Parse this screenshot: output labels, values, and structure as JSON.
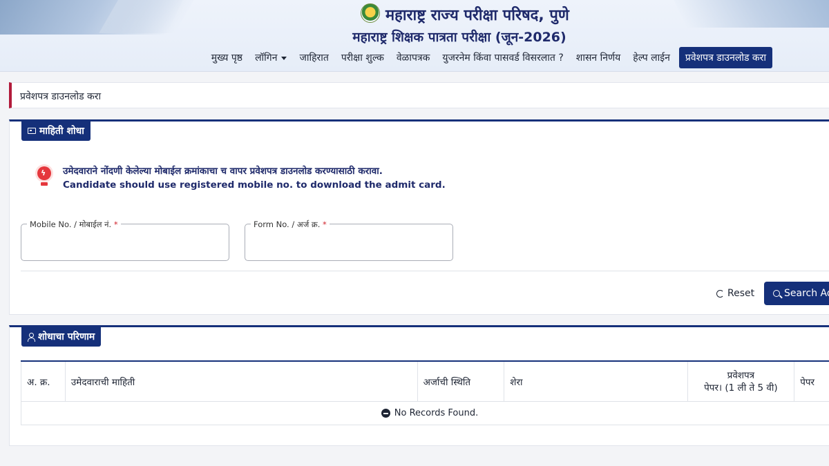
{
  "header": {
    "title": "महाराष्ट्र राज्य परीक्षा परिषद, पुणे",
    "subtitle": "महाराष्ट्र शिक्षक पात्रता परीक्षा (जून-2026)",
    "nav": [
      {
        "label": "मुख्य पृष्ठ"
      },
      {
        "label": "लॉगिन"
      },
      {
        "label": "जाहिरात"
      },
      {
        "label": "परीक्षा शुल्क"
      },
      {
        "label": "वेळापत्रक"
      },
      {
        "label": "युजरनेम किंवा पासवर्ड विसरलात ?"
      },
      {
        "label": "शासन निर्णय"
      },
      {
        "label": "हेल्प लाईन"
      },
      {
        "label": "प्रवेशपत्र डाउनलोड करा"
      }
    ]
  },
  "breadcrumb": "प्रवेशपत्र डाउनलोड करा",
  "search_panel": {
    "tab": "माहिती शोधा",
    "notice_line1": "उमेदवाराने नोंदणी केलेल्या मोबाईल क्रमांकाचा च वापर प्रवेशपत्र डाउनलोड करण्यासाठी करावा.",
    "notice_line2": "Candidate should use registered mobile no. to download the admit card.",
    "mobile_label": "Mobile No. / मोबाईल नं.",
    "mobile_value": "",
    "form_label": "Form No. / अर्ज क्र.",
    "form_value": "",
    "required_mark": "*",
    "reset_label": "Reset",
    "search_label": "Search Ad"
  },
  "result_panel": {
    "tab": "शोधाचा परिणाम",
    "columns": [
      "अ. क्र.",
      "उमेदवाराची माहिती",
      "अर्जाची स्थिति",
      "शेरा",
      "प्रवेशपत्र",
      "पेपर। (1 ली ते 5 वी)",
      "पेपर"
    ],
    "empty_message": "No Records Found."
  },
  "colors": {
    "primary": "#15307a",
    "accent_red": "#b21b3b",
    "alert_red": "#e5373d"
  }
}
